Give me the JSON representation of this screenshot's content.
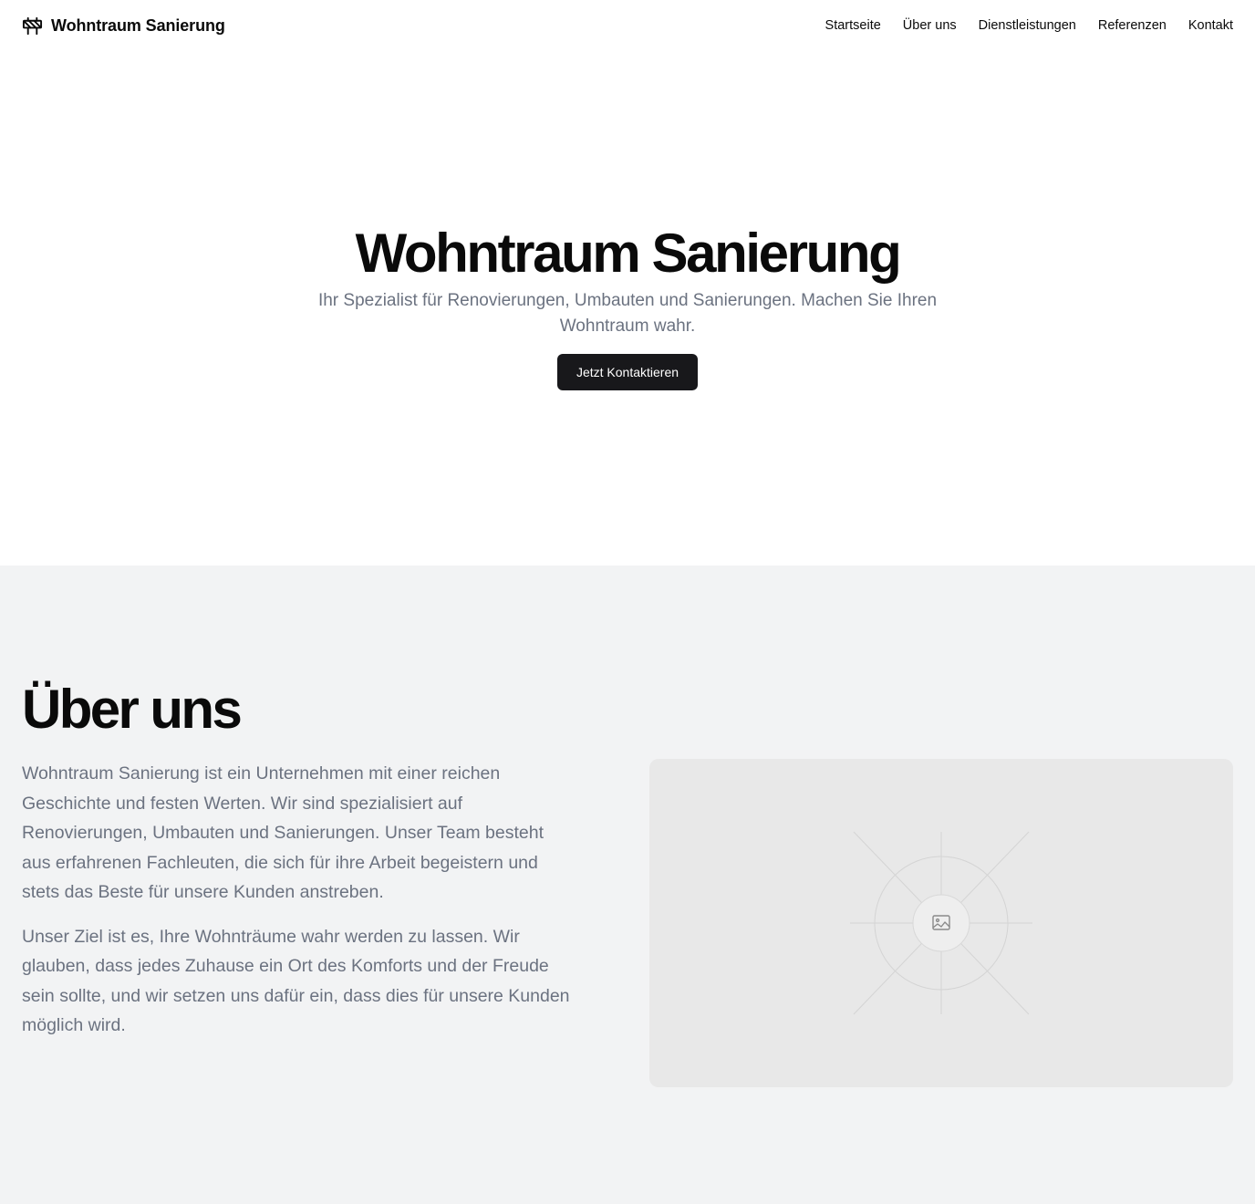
{
  "header": {
    "brand_name": "Wohntraum Sanierung",
    "brand_icon": "construction-barrier-icon",
    "nav": [
      {
        "label": "Startseite"
      },
      {
        "label": "Über uns"
      },
      {
        "label": "Dienstleistungen"
      },
      {
        "label": "Referenzen"
      },
      {
        "label": "Kontakt"
      }
    ]
  },
  "hero": {
    "title": "Wohntraum Sanierung",
    "subtitle": "Ihr Spezialist für Renovierungen, Umbauten und Sanierungen. Machen Sie Ihren Wohntraum wahr.",
    "cta_label": "Jetzt Kontaktieren"
  },
  "about": {
    "title": "Über uns",
    "paragraphs": [
      "Wohntraum Sanierung ist ein Unternehmen mit einer reichen Geschichte und festen Werten. Wir sind spezialisiert auf Renovierungen, Umbauten und Sanierungen. Unser Team besteht aus erfahrenen Fachleuten, die sich für ihre Arbeit begeistern und stets das Beste für unsere Kunden anstreben.",
      "Unser Ziel ist es, Ihre Wohnträume wahr werden zu lassen. Wir glauben, dass jedes Zuhause ein Ort des Komforts und der Freude sein sollte, und wir setzen uns dafür ein, dass dies für unsere Kunden möglich wird."
    ],
    "image_icon": "image-placeholder-icon"
  },
  "colors": {
    "text_primary": "#0a0a0a",
    "text_muted": "#6b7280",
    "button_bg": "#18181b",
    "section_bg": "#f2f3f4",
    "placeholder_bg": "#e8e8e8"
  }
}
